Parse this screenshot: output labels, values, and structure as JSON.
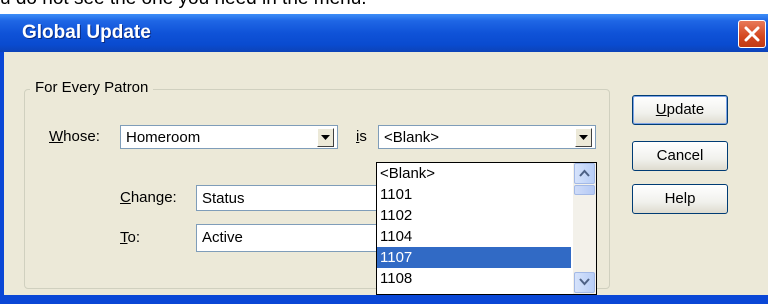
{
  "top_text": "u do not see the one you need in the menu.",
  "dialog": {
    "title": "Global Update",
    "group_label": "For Every Patron",
    "whose_label_u": "W",
    "whose_label_rest": "hose:",
    "whose_value": "Homeroom",
    "is_label_u": "i",
    "is_label_rest": "s",
    "is_value": "<Blank>",
    "change_label_u": "C",
    "change_label_rest": "hange:",
    "change_value": "Status",
    "to_label_u": "T",
    "to_label_rest": "o:",
    "to_value": "Active",
    "dropdown_options": [
      "<Blank>",
      "1101",
      "1102",
      "1104",
      "1107",
      "1108"
    ],
    "selected_option": "1107",
    "buttons": {
      "update_u": "U",
      "update_rest": "pdate",
      "cancel": "Cancel",
      "help": "Help"
    }
  },
  "colors": {
    "titlebar": "#0a4bd0",
    "selection": "#316ac5",
    "dialog_bg": "#ece9d8",
    "close_button": "#d4471f"
  }
}
